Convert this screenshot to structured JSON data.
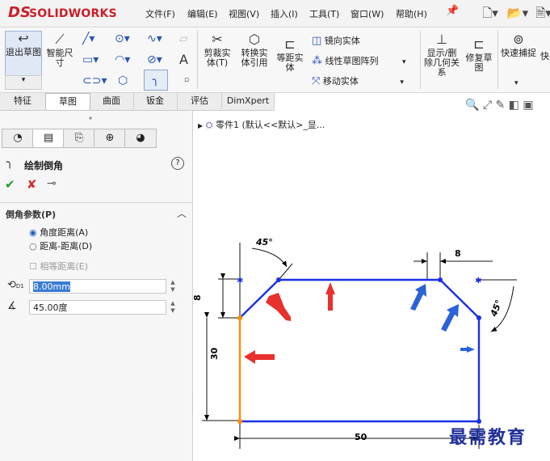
{
  "app": {
    "logo_mark": "DS",
    "logo_text": "SOLIDWORKS"
  },
  "menu": [
    "文件(F)",
    "编辑(E)",
    "视图(V)",
    "插入(I)",
    "工具(T)",
    "窗口(W)",
    "帮助(H)"
  ],
  "ribbon": {
    "exit_sketch": "退出草图",
    "smart_dimension": "智能尺寸",
    "trim_entities": "剪裁实体(T)",
    "convert_entities": "转换实体引用",
    "offset_entities": "等距实体",
    "mirror_entities": "镜向实体",
    "linear_pattern": "线性草图阵列",
    "move_entities": "移动实体",
    "show_relations": "显示/删除几何关系",
    "repair_sketch": "修复草图",
    "quick_snaps": "快速捕捉",
    "quick_more": "快"
  },
  "tabs": [
    "特征",
    "草图",
    "曲面",
    "钣金",
    "评估",
    "DimXpert"
  ],
  "active_tab": "草图",
  "tree": {
    "part_label": "零件1 (默认<<默认>_显..."
  },
  "panel": {
    "title": "绘制倒角",
    "help_label": "?",
    "section": "倒角参数(P)",
    "option_angle": "角度距离(A)",
    "option_distance": "距离-距离(D)",
    "equal_distance": "相等距离(E)",
    "d1_label": "D1",
    "d1_value": "8.00mm",
    "angle_value": "45.00度"
  },
  "drawing": {
    "dim_top": "8",
    "dim_left": "8",
    "dim_height": "30",
    "dim_width": "50",
    "angle_left": "45°",
    "angle_right": "45°"
  },
  "watermark": "最需教育",
  "colors": {
    "sketch": "#1a2fe8",
    "arrow_red": "#e8302e",
    "arrow_blue": "#2a62d8",
    "highlight": "#ff8c00"
  }
}
